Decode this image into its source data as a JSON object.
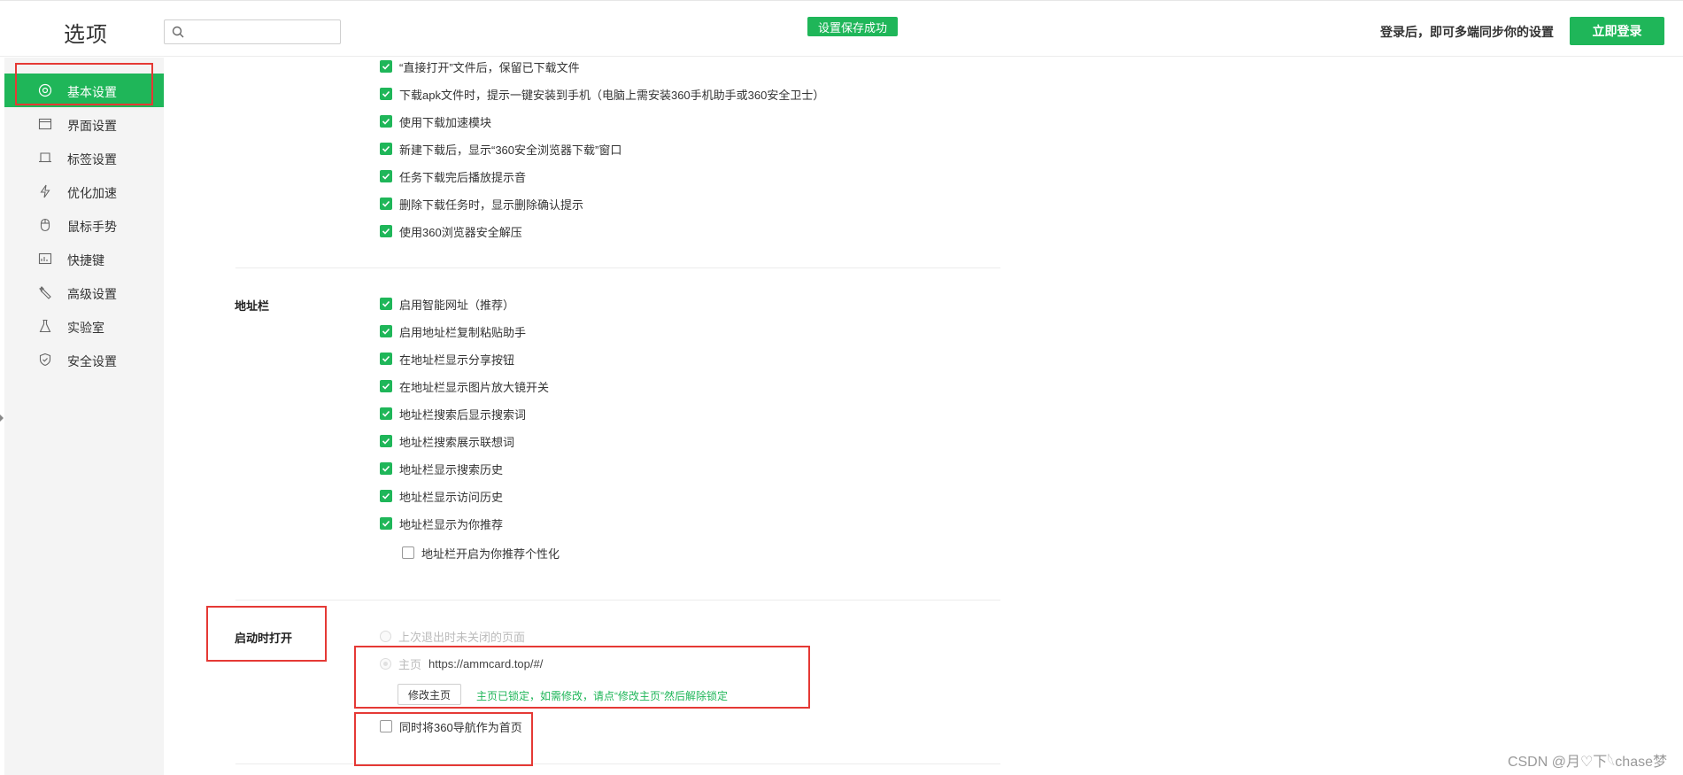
{
  "header": {
    "title": "选项",
    "search_placeholder": "",
    "toast": "设置保存成功",
    "sync_hint": "登录后，即可多端同步你的设置",
    "login_label": "立即登录"
  },
  "sidebar": {
    "items": [
      {
        "label": "基本设置",
        "icon": "settings-circle-icon",
        "active": true
      },
      {
        "label": "界面设置",
        "icon": "window-layout-icon"
      },
      {
        "label": "标签设置",
        "icon": "tab-icon"
      },
      {
        "label": "优化加速",
        "icon": "lightning-icon"
      },
      {
        "label": "鼠标手势",
        "icon": "mouse-icon"
      },
      {
        "label": "快捷键",
        "icon": "keyboard-icon"
      },
      {
        "label": "高级设置",
        "icon": "wrench-icon"
      },
      {
        "label": "实验室",
        "icon": "flask-icon"
      },
      {
        "label": "安全设置",
        "icon": "shield-icon"
      }
    ]
  },
  "download": {
    "options": [
      {
        "label": "“直接打开”文件后，保留已下载文件",
        "checked": true
      },
      {
        "label": "下载apk文件时，提示一键安装到手机（电脑上需安装360手机助手或360安全卫士）",
        "checked": true
      },
      {
        "label": "使用下载加速模块",
        "checked": true
      },
      {
        "label": "新建下载后，显示“360安全浏览器下载”窗口",
        "checked": true
      },
      {
        "label": "任务下载完后播放提示音",
        "checked": true
      },
      {
        "label": "删除下载任务时，显示删除确认提示",
        "checked": true
      },
      {
        "label": "使用360浏览器安全解压",
        "checked": true
      }
    ]
  },
  "address_bar": {
    "title": "地址栏",
    "options": [
      {
        "label": "启用智能网址（推荐）",
        "checked": true
      },
      {
        "label": "启用地址栏复制粘贴助手",
        "checked": true
      },
      {
        "label": "在地址栏显示分享按钮",
        "checked": true
      },
      {
        "label": "在地址栏显示图片放大镜开关",
        "checked": true
      },
      {
        "label": "地址栏搜索后显示搜索词",
        "checked": true
      },
      {
        "label": "地址栏搜索展示联想词",
        "checked": true
      },
      {
        "label": "地址栏显示搜索历史",
        "checked": true
      },
      {
        "label": "地址栏显示访问历史",
        "checked": true
      },
      {
        "label": "地址栏显示为你推荐",
        "checked": true
      }
    ],
    "sub_option": {
      "label": "地址栏开启为你推荐个性化",
      "checked": false
    }
  },
  "startup": {
    "title": "启动时打开",
    "restore_label": "上次退出时未关闭的页面",
    "homepage_label": "主页",
    "homepage_url": "https://ammcard.top/#/",
    "modify_button": "修改主页",
    "locked_note": "主页已锁定，如需修改，请点“修改主页”然后解除锁定",
    "nav_home_label": "同时将360导航作为首页",
    "nav_home_checked": false
  },
  "watermark": "CSDN @月♡下𓆩chase梦",
  "colors": {
    "accent": "#1fb659",
    "annotation": "#e53935"
  }
}
